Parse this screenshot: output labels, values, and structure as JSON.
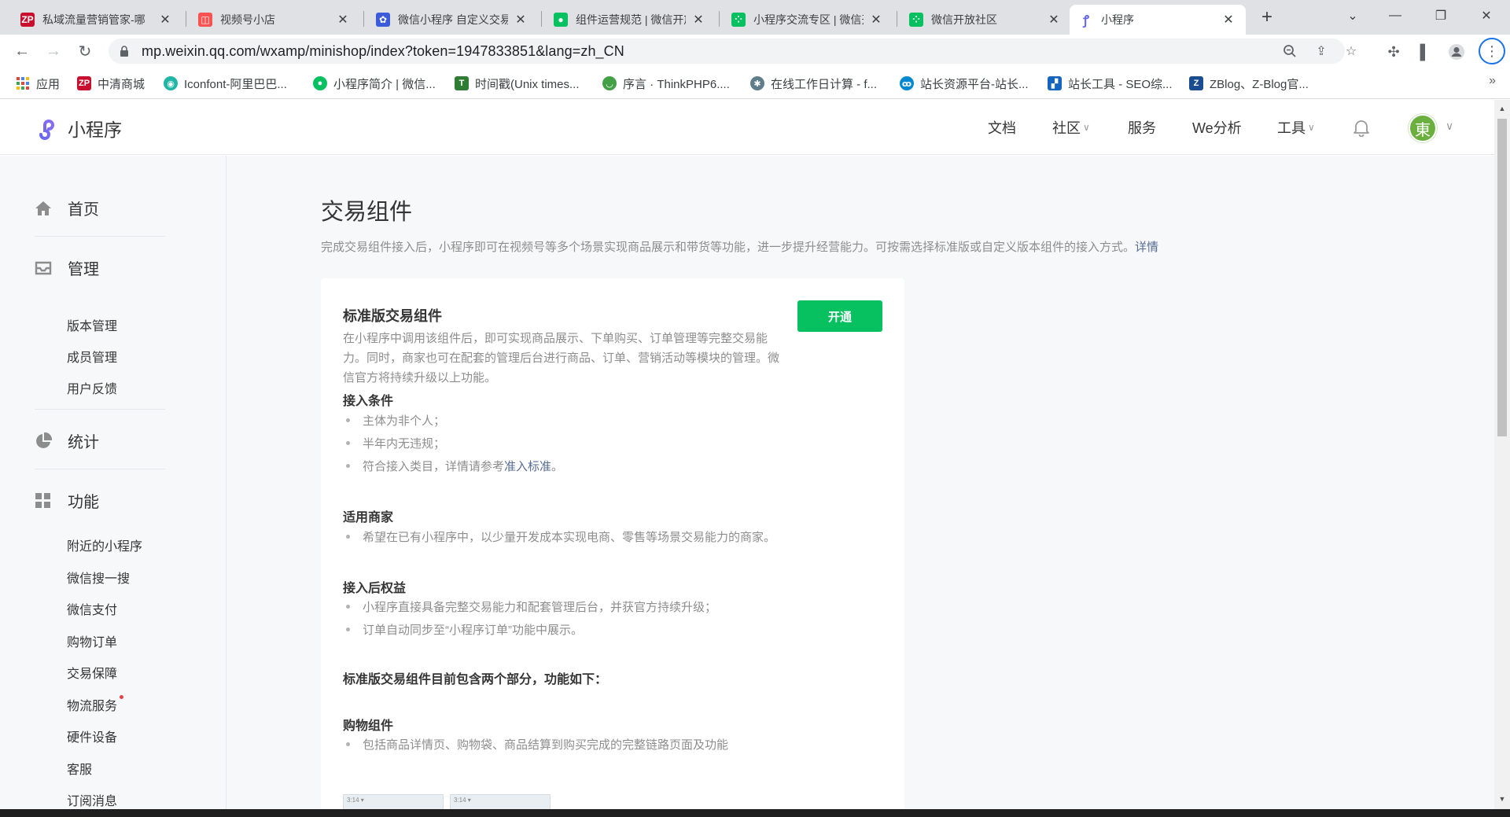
{
  "tabs": [
    {
      "title": "私域流量营销管家-哪",
      "icon_color": "#c8102e",
      "icon_text": "ZP"
    },
    {
      "title": "视频号小店",
      "icon_color": "#fa5151",
      "icon_text": "◫"
    },
    {
      "title": "微信小程序 自定义交易组件",
      "icon_color": "#3b5bdb",
      "icon_text": "✿"
    },
    {
      "title": "组件运营规范 | 微信开放文档",
      "icon_color": "#07c160",
      "icon_text": "●"
    },
    {
      "title": "小程序交流专区 | 微信开放社区",
      "icon_color": "#07c160",
      "icon_text": "⁘"
    },
    {
      "title": "微信开放社区",
      "icon_color": "#07c160",
      "icon_text": "⁘"
    },
    {
      "title": "小程序",
      "icon_color": "#6467f0",
      "icon_text": "ꝭ"
    }
  ],
  "tab_close": "✕",
  "new_tab": "+",
  "address": {
    "url": "mp.weixin.qq.com/wxamp/minishop/index?token=1947833851&lang=zh_CN"
  },
  "bookmarks": [
    {
      "label": "应用",
      "icon_color": "#4285f4"
    },
    {
      "label": "中清商城",
      "icon_color": "#c8102e"
    },
    {
      "label": "Iconfont-阿里巴巴...",
      "icon_color": "#1fb6a6"
    },
    {
      "label": "小程序简介 | 微信...",
      "icon_color": "#07c160"
    },
    {
      "label": "时间戳(Unix times...",
      "icon_color": "#2e7d32"
    },
    {
      "label": "序言 · ThinkPHP6....",
      "icon_color": "#43a047"
    },
    {
      "label": "在线工作日计算 - f...",
      "icon_color": "#607d8b"
    },
    {
      "label": "站长资源平台-站长...",
      "icon_color": "#0288d1"
    },
    {
      "label": "站长工具 - SEO综...",
      "icon_color": "#1565c0"
    },
    {
      "label": "ZBlog、Z-Blog官...",
      "icon_color": "#1a4d8f"
    }
  ],
  "bookmarks_more": "»",
  "header": {
    "logo_text": "小程序",
    "nav": [
      {
        "label": "文档",
        "dropdown": false
      },
      {
        "label": "社区",
        "dropdown": true
      },
      {
        "label": "服务",
        "dropdown": false
      },
      {
        "label": "We分析",
        "dropdown": false
      },
      {
        "label": "工具",
        "dropdown": true
      }
    ],
    "avatar_text": "東"
  },
  "sidebar": {
    "home": "首页",
    "manage": "管理",
    "manage_items": [
      "版本管理",
      "成员管理",
      "用户反馈"
    ],
    "stats": "统计",
    "features": "功能",
    "feature_items": [
      "附近的小程序",
      "微信搜一搜",
      "微信支付",
      "购物订单",
      "交易保障",
      "物流服务",
      "硬件设备",
      "客服",
      "订阅消息"
    ]
  },
  "main": {
    "title": "交易组件",
    "desc": "完成交易组件接入后，小程序即可在视频号等多个场景实现商品展示和带货等功能，进一步提升经营能力。可按需选择标准版或自定义版本组件的接入方式。",
    "desc_link": "详情",
    "card": {
      "title": "标准版交易组件",
      "intro": "在小程序中调用该组件后，即可实现商品展示、下单购买、订单管理等完整交易能力。同时，商家也可在配套的管理后台进行商品、订单、营销活动等模块的管理。微信官方将持续升级以上功能。",
      "open_button": "开通",
      "sec1_title": "接入条件",
      "sec1_items": [
        "主体为非个人；",
        "半年内无违规；",
        "符合接入类目，详情请参考"
      ],
      "sec1_link": "准入标准",
      "sec1_link_suffix": "。",
      "sec2_title": "适用商家",
      "sec2_items": [
        "希望在已有小程序中，以少量开发成本实现电商、零售等场景交易能力的商家。"
      ],
      "sec3_title": "接入后权益",
      "sec3_items": [
        "小程序直接具备完整交易能力和配套管理后台，并获官方持续升级；",
        "订单自动同步至“小程序订单”功能中展示。"
      ],
      "sec4_title": "标准版交易组件目前包含两个部分，功能如下：",
      "sec5_title": "购物组件",
      "sec5_items": [
        "包括商品详情页、购物袋、商品结算到购买完成的完整链路页面及功能"
      ],
      "thumb_text": "3:14 ▾"
    }
  }
}
